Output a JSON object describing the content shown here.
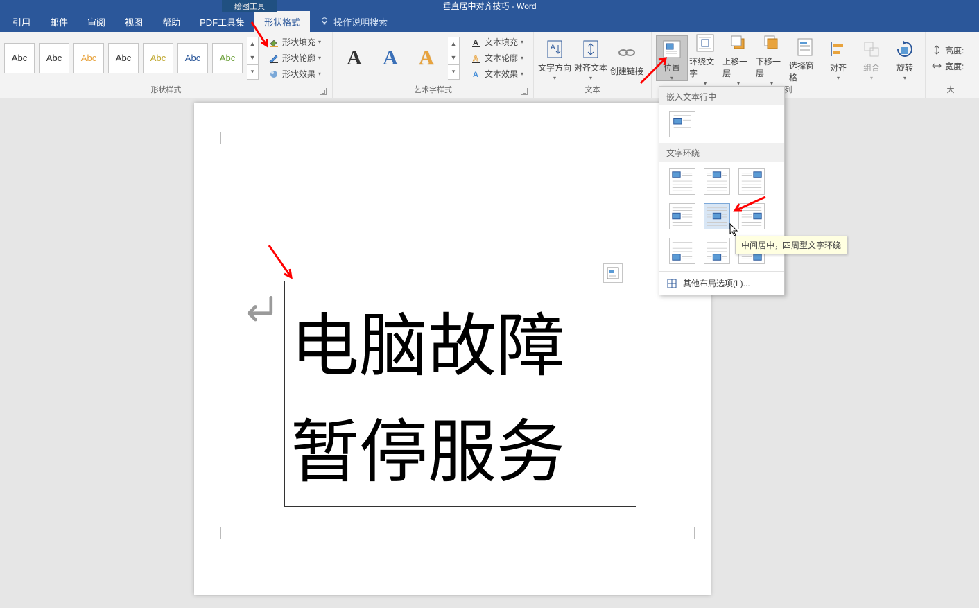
{
  "titlebar": {
    "contextual": "绘图工具",
    "doc": "垂直居中对齐技巧 - Word"
  },
  "tabs": {
    "items": [
      "引用",
      "邮件",
      "审阅",
      "视图",
      "帮助",
      "PDF工具集",
      "形状格式"
    ],
    "tell": "操作说明搜索"
  },
  "ribbon": {
    "style_swatch_text": "Abc",
    "shape_fill": "形状填充",
    "shape_outline": "形状轮廓",
    "shape_effects": "形状效果",
    "group_shape_styles": "形状样式",
    "wa_letter": "A",
    "text_fill": "文本填充",
    "text_outline": "文本轮廓",
    "text_effects": "文本效果",
    "group_wordart": "艺术字样式",
    "text_direction": "文字方向",
    "align_text": "对齐文本",
    "create_link": "创建链接",
    "group_text": "文本",
    "position": "位置",
    "wrap_text": "环绕文字",
    "bring_forward": "上移一层",
    "send_backward": "下移一层",
    "selection_pane": "选择窗格",
    "align": "对齐",
    "group_obj": "组合",
    "rotate": "旋转",
    "group_arrange_tail": "列",
    "size_height": "高度:",
    "size_width": "宽度:",
    "group_size_tail": "大"
  },
  "pos_panel": {
    "section1": "嵌入文本行中",
    "section2": "文字环绕",
    "more": "其他布局选项(L)..."
  },
  "tooltip": "中间居中，四周型文字环绕",
  "textbox": {
    "line1": "电脑故障",
    "line2": "暂停服务"
  }
}
